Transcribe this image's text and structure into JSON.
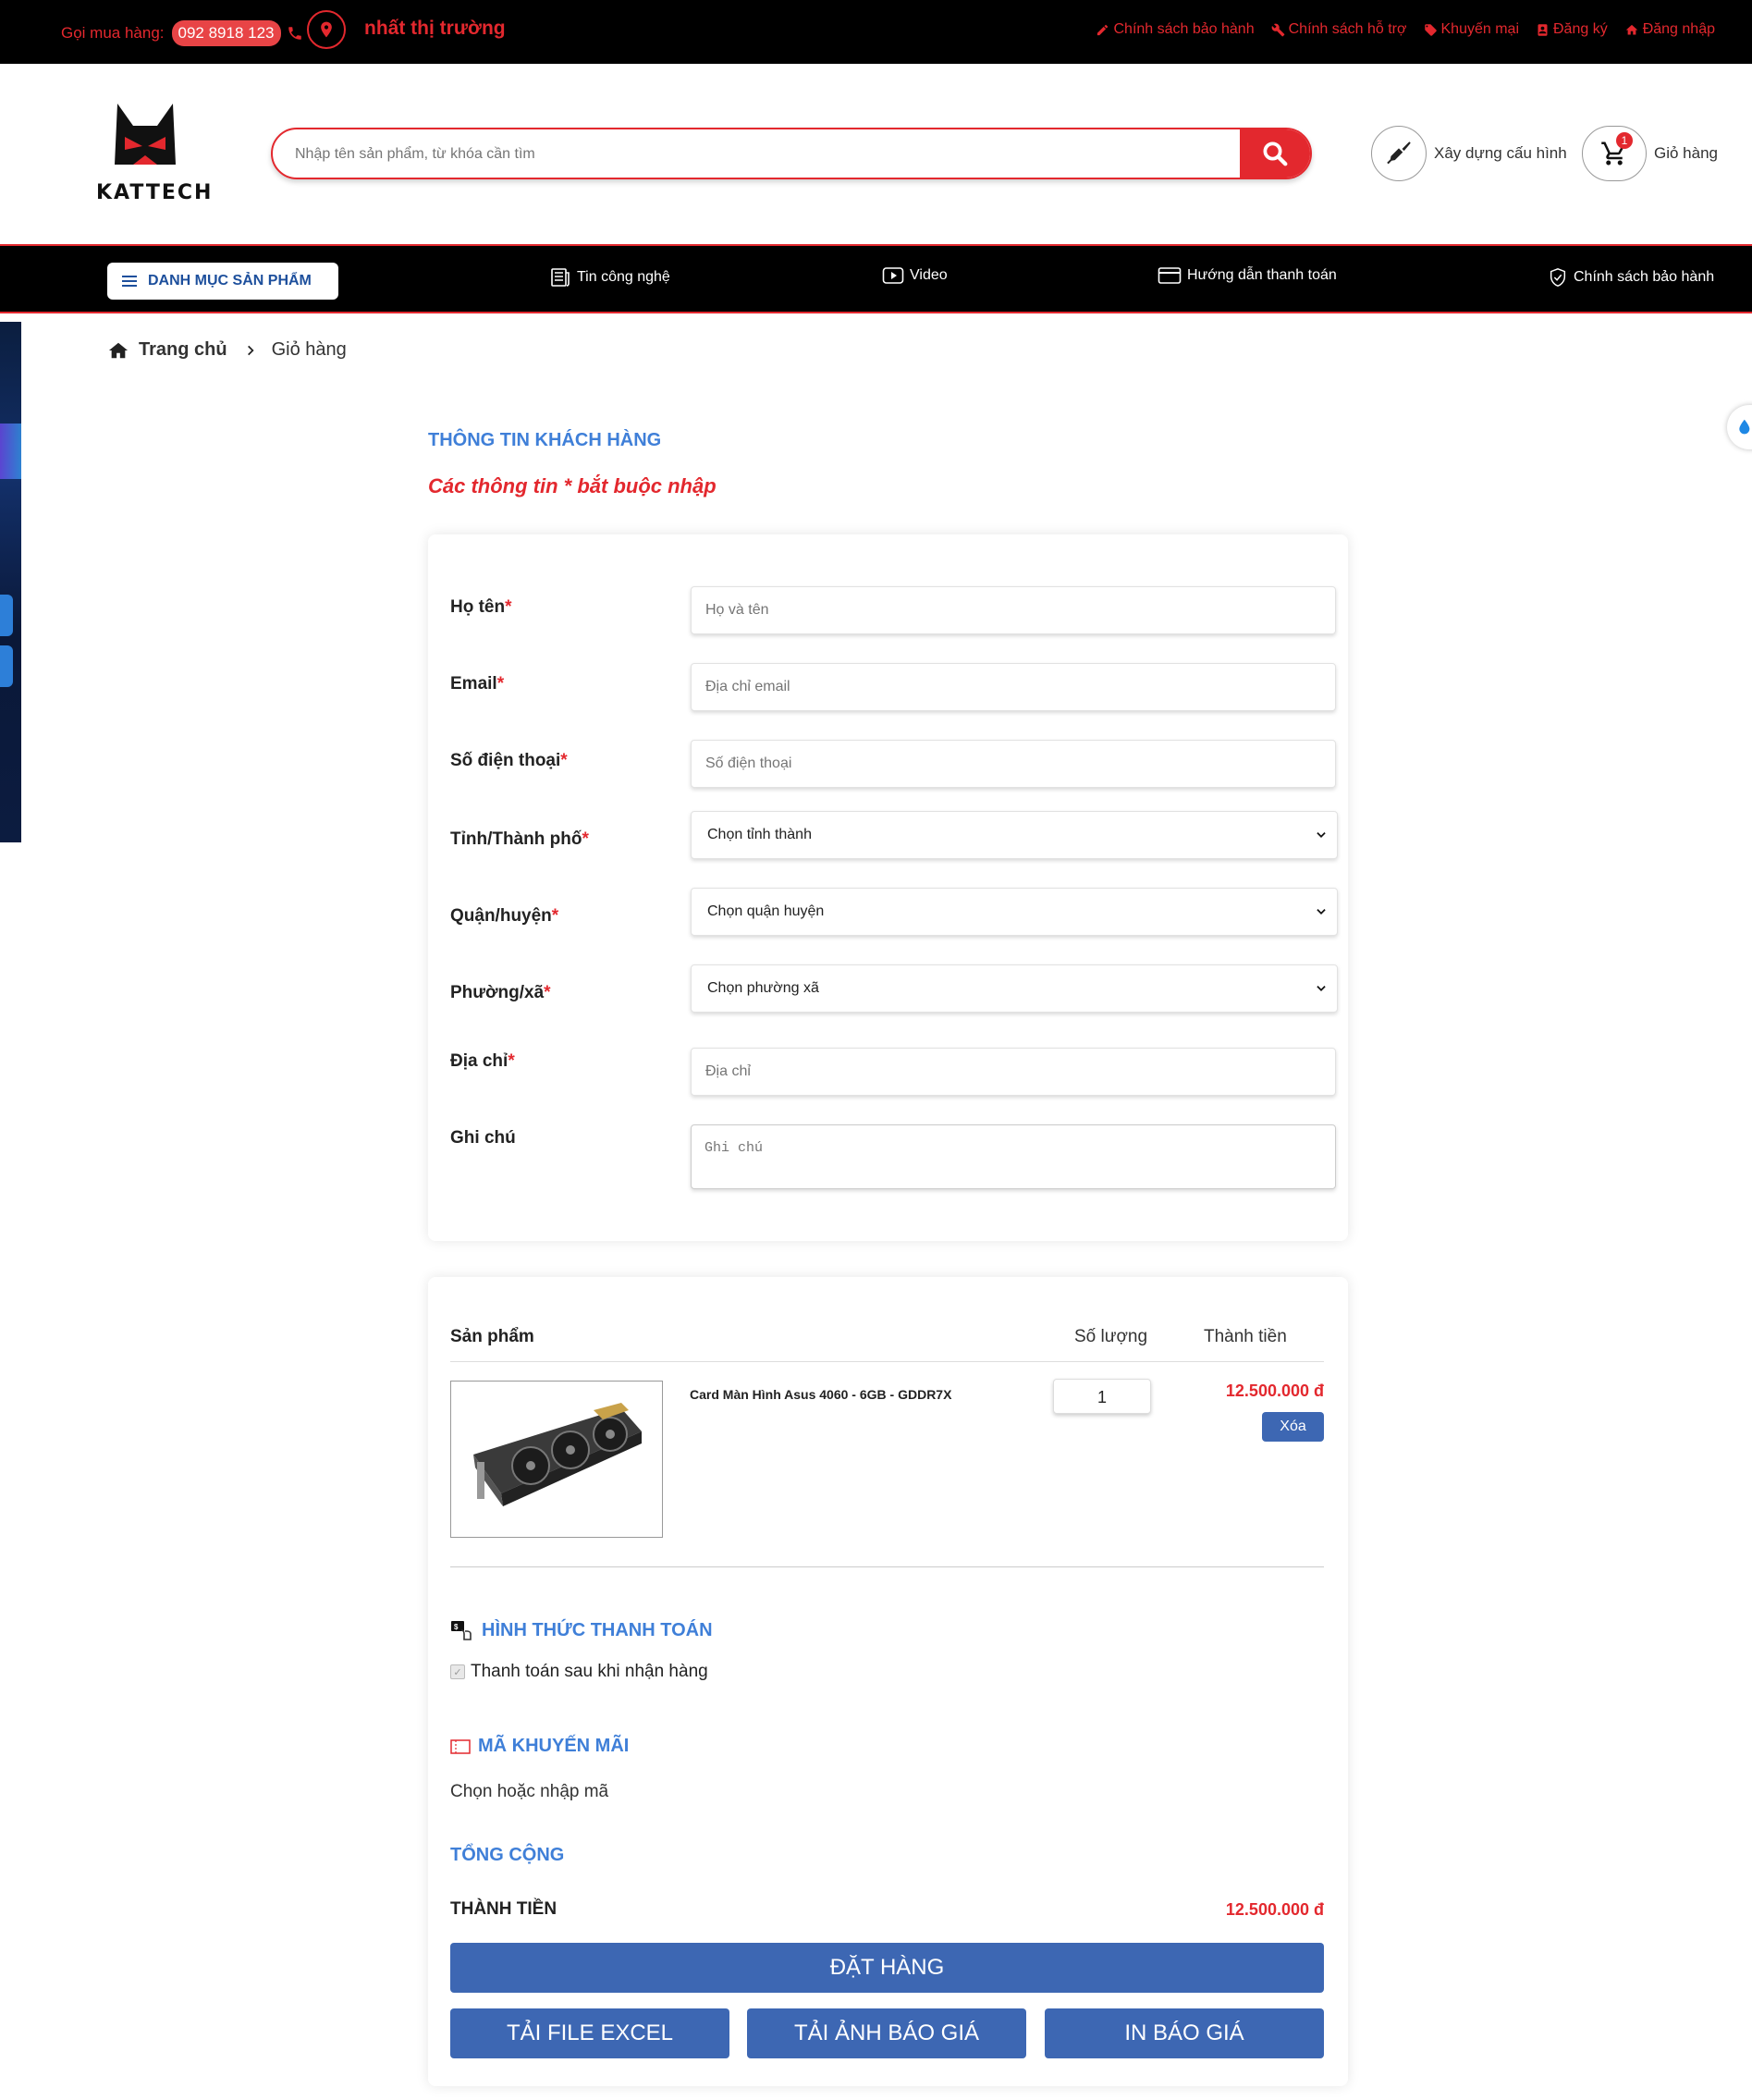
{
  "topbar": {
    "call_label": "Gọi mua hàng:",
    "phone": "092 8918 123",
    "marquee": "nhất thị trường",
    "links": [
      {
        "label": "Chính sách bảo hành",
        "icon": "pencil-icon"
      },
      {
        "label": "Chính sách hỗ trợ",
        "icon": "wrench-icon"
      },
      {
        "label": "Khuyến mại",
        "icon": "tag-icon"
      },
      {
        "label": "Đăng ký",
        "icon": "id-card-icon"
      },
      {
        "label": "Đăng nhập",
        "icon": "home-icon"
      }
    ]
  },
  "header": {
    "logo_text": "KATTECH",
    "search_placeholder": "Nhập tên sản phẩm, từ khóa cần tìm",
    "build_label": "Xây dựng cấu hình",
    "cart_label": "Giỏ hàng",
    "cart_count": "1"
  },
  "nav": {
    "category_label": "DANH MỤC SẢN PHẨM",
    "items": [
      {
        "label": "Tin công nghệ",
        "icon": "newspaper-icon"
      },
      {
        "label": "Video",
        "icon": "play-icon"
      },
      {
        "label": "Hướng dẫn thanh toán",
        "icon": "credit-card-icon"
      },
      {
        "label": "Chính sách bảo hành",
        "icon": "shield-icon"
      }
    ]
  },
  "breadcrumb": {
    "home": "Trang chủ",
    "current": "Giỏ hàng"
  },
  "customer": {
    "title": "THÔNG TIN KHÁCH HÀNG",
    "note": "Các thông tin * bắt buộc nhập",
    "fields": {
      "name": {
        "label": "Họ tên",
        "placeholder": "Họ và tên"
      },
      "email": {
        "label": "Email",
        "placeholder": "Địa chỉ email"
      },
      "phone": {
        "label": "Số điện thoại",
        "placeholder": "Số điện thoại"
      },
      "city": {
        "label": "Tỉnh/Thành phố",
        "value": "Chọn tỉnh thành"
      },
      "district": {
        "label": "Quận/huyện",
        "value": "Chọn quận huyện"
      },
      "ward": {
        "label": "Phường/xã",
        "value": "Chọn phường xã"
      },
      "address": {
        "label": "Địa chỉ",
        "placeholder": "Địa chỉ"
      },
      "note": {
        "label": "Ghi chú",
        "placeholder": "Ghi chú"
      }
    },
    "required_mark": "*"
  },
  "cart": {
    "headers": {
      "product": "Sản phẩm",
      "qty": "Số lượng",
      "total": "Thành tiền"
    },
    "items": [
      {
        "name": "Card Màn Hình Asus 4060 - 6GB - GDDR7X",
        "qty": "1",
        "price": "12.500.000 đ",
        "delete_label": "Xóa"
      }
    ],
    "payment_title": "HÌNH THỨC THANH TOÁN",
    "payment_option": "Thanh toán sau khi nhận hàng",
    "promo_title": "MÃ KHUYẾN MÃI",
    "promo_text": "Chọn hoặc nhập mã",
    "summary_title": "TỔNG CỘNG",
    "total_label": "THÀNH TIỀN",
    "total_value": "12.500.000 đ",
    "order_button": "ĐẶT HÀNG",
    "excel_button": "TẢI FILE EXCEL",
    "image_button": "TẢI ẢNH BÁO GIÁ",
    "print_button": "IN BÁO GIÁ"
  },
  "colors": {
    "brand_red": "#e3282e",
    "accent_blue": "#3f7fd8",
    "button_blue": "#3d67b3",
    "topbar_bg": "#000000"
  }
}
